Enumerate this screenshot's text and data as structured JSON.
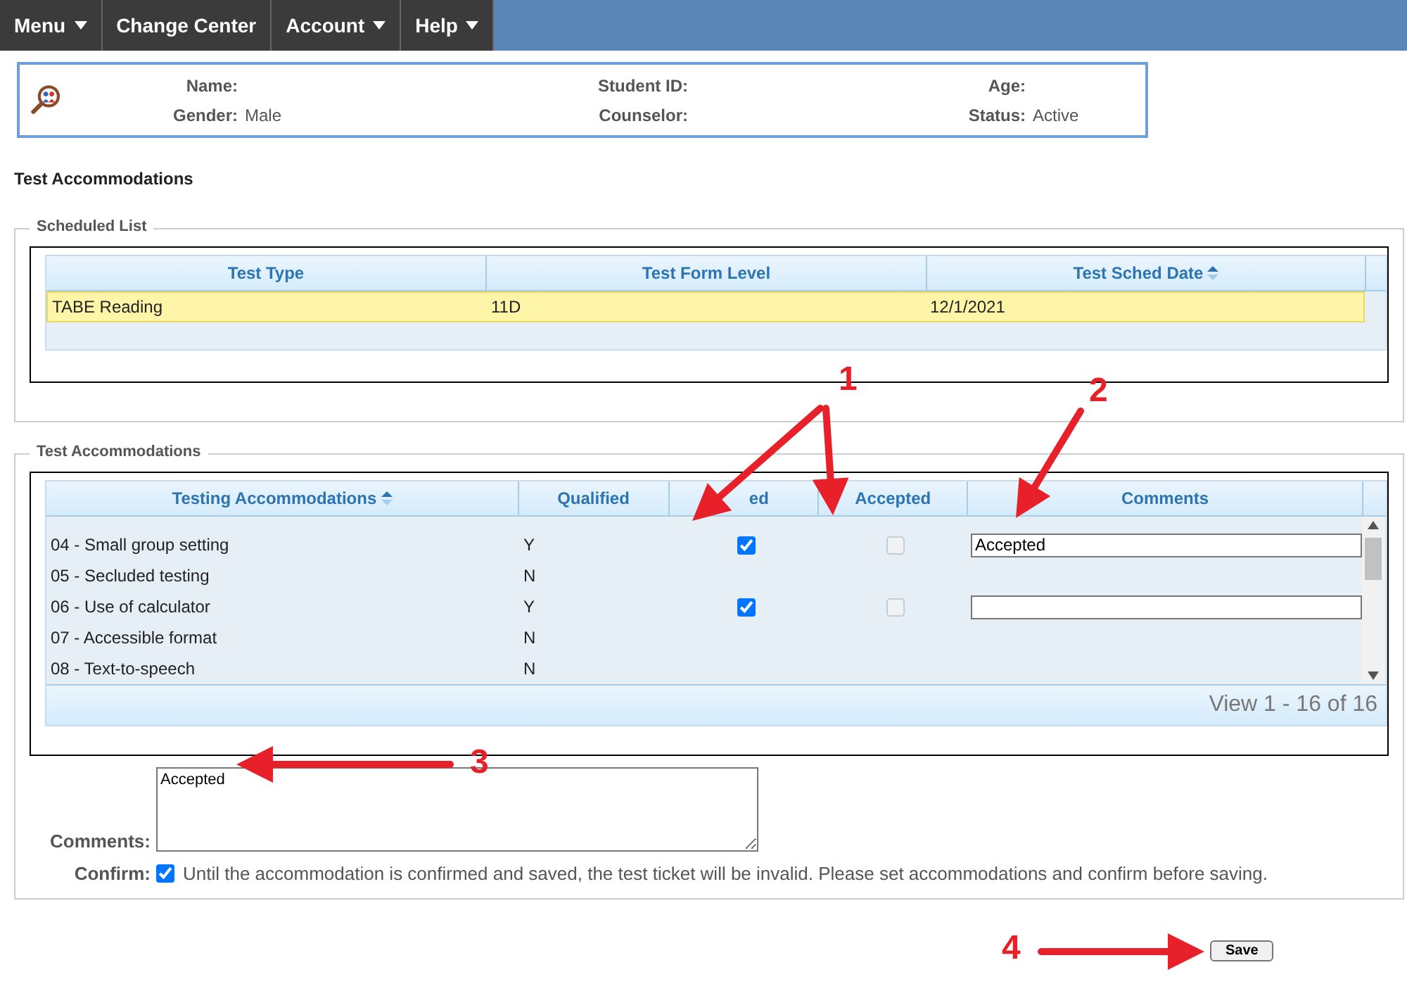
{
  "menu": [
    {
      "label": "Menu",
      "dropdown": true
    },
    {
      "label": "Change Center",
      "dropdown": false
    },
    {
      "label": "Account",
      "dropdown": true
    },
    {
      "label": "Help",
      "dropdown": true
    }
  ],
  "student": {
    "name_label": "Name:",
    "student_id_label": "Student ID:",
    "age_label": "Age:",
    "gender_label": "Gender:",
    "gender": "Male",
    "counselor_label": "Counselor:",
    "status_label": "Status:",
    "status": "Active"
  },
  "page_title": "Test Accommodations",
  "scheduled_list": {
    "legend": "Scheduled List",
    "columns": [
      "Test Type",
      "Test Form Level",
      "Test Sched Date"
    ],
    "rows": [
      {
        "cells": [
          "TABE Reading",
          "11D",
          "12/1/2021"
        ],
        "selected": true
      }
    ]
  },
  "accommodations": {
    "legend": "Test Accommodations",
    "columns": [
      "Testing Accommodations",
      "Qualified",
      "ed",
      "Accepted",
      "Comments"
    ],
    "rows": [
      {
        "name": "04 - Small group setting",
        "qualified": "Y",
        "kind": "editable",
        "offered": true,
        "accepted": false,
        "comment": "Accepted"
      },
      {
        "name": "05 - Secluded testing",
        "qualified": "N",
        "kind": "plain"
      },
      {
        "name": "06 - Use of calculator",
        "qualified": "Y",
        "kind": "editable",
        "offered": true,
        "accepted": false,
        "comment": ""
      },
      {
        "name": "07 - Accessible format",
        "qualified": "N",
        "kind": "plain"
      },
      {
        "name": "08 - Text-to-speech",
        "qualified": "N",
        "kind": "plain"
      }
    ],
    "pager": "View 1 - 16 of 16"
  },
  "comments": {
    "label": "Comments:",
    "value": "Accepted"
  },
  "confirm": {
    "label": "Confirm:",
    "checked": true,
    "text": "Until the accommodation is confirmed and saved, the test ticket will be invalid. Please set accommodations and confirm before saving."
  },
  "save_button": "Save",
  "annotations": [
    "1",
    "2",
    "3",
    "4"
  ]
}
